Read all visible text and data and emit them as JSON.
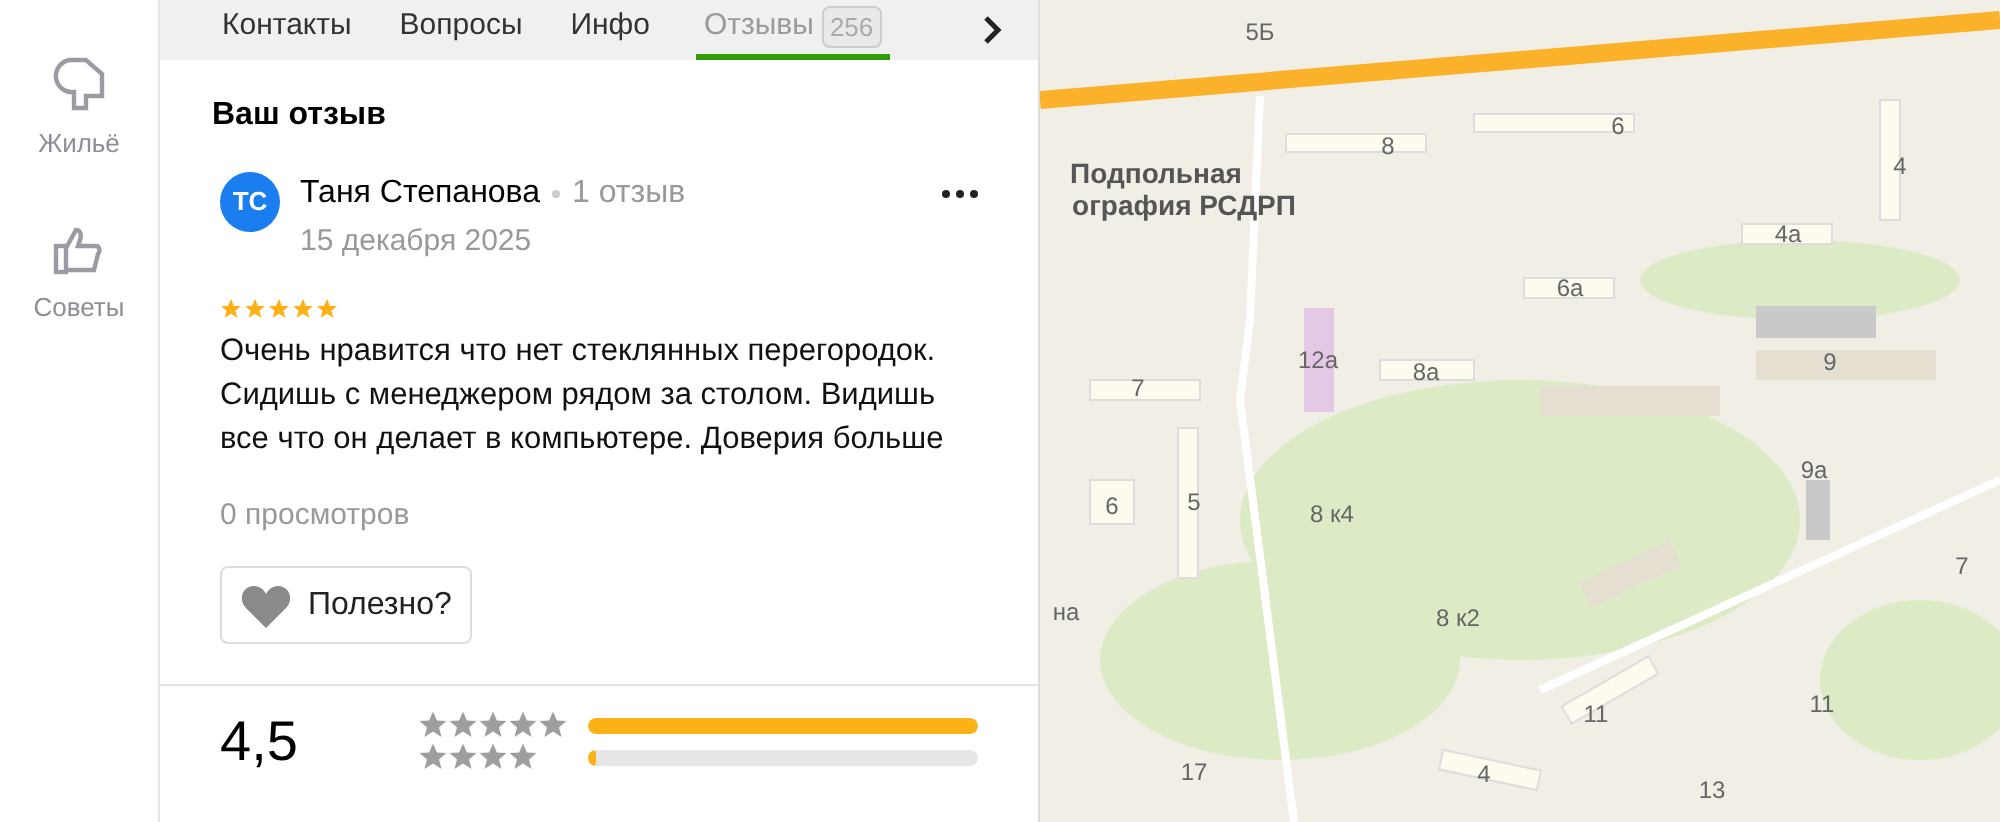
{
  "nav": [
    {
      "label": "Жильё",
      "kind": "housing"
    },
    {
      "label": "Советы",
      "kind": "tips"
    }
  ],
  "tabs": [
    {
      "label": "Контакты",
      "selected": false
    },
    {
      "label": "Вопросы",
      "selected": false
    },
    {
      "label": "Инфо",
      "selected": false
    },
    {
      "label": "Отзывы",
      "count": "256",
      "selected": true
    }
  ],
  "review": {
    "heading": "Ваш отзыв",
    "initials": "ТС",
    "author": "Таня Степанова",
    "author_reviews": "1 отзыв",
    "date": "15 декабря 2025",
    "stars": 5,
    "text": "Очень нравится что нет стеклянных перегородок. Сидишь с менеджером рядом за столом. Видишь все что он делает в компьютере. Доверия больше",
    "views": "0 просмотров",
    "helpful_button": "Полезно?"
  },
  "rating": {
    "score": "4,5",
    "rows": [
      {
        "stars": 5,
        "level": 1.0
      },
      {
        "stars": 4,
        "level": 0.02
      }
    ]
  },
  "map": {
    "labels": [
      "5Б",
      "6",
      "8",
      "4",
      "Подпольная",
      "ография РСДРП",
      "4а",
      "6а",
      "12а",
      "9",
      "8а",
      "7",
      "9а",
      "5",
      "6",
      "8 к4",
      "7",
      "на",
      "8 к2",
      "11",
      "11",
      "17",
      "4",
      "13"
    ]
  }
}
